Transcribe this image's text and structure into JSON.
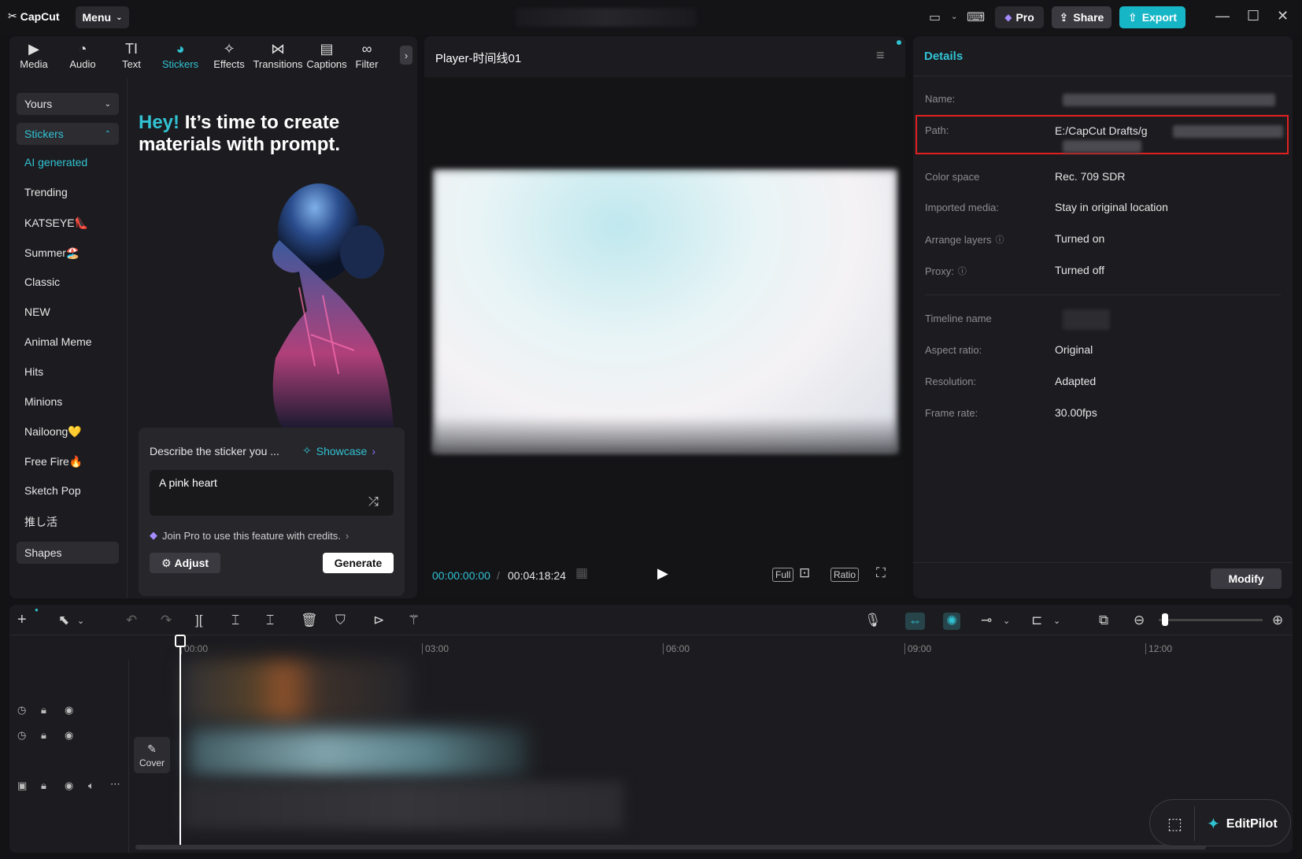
{
  "app": {
    "logo_text": "CapCut",
    "menu_label": "Menu"
  },
  "header": {
    "pro_label": "Pro",
    "share_label": "Share",
    "export_label": "Export"
  },
  "toolbar": {
    "tools": [
      {
        "label": "Media",
        "icon": "media-icon"
      },
      {
        "label": "Audio",
        "icon": "audio-icon"
      },
      {
        "label": "Text",
        "icon": "text-icon"
      },
      {
        "label": "Stickers",
        "icon": "stickers-icon"
      },
      {
        "label": "Effects",
        "icon": "effects-icon"
      },
      {
        "label": "Transitions",
        "icon": "transitions-icon"
      },
      {
        "label": "Captions",
        "icon": "captions-icon"
      },
      {
        "label": "Filter",
        "icon": "filter-icon"
      }
    ]
  },
  "sidebar": {
    "yours_label": "Yours",
    "stickers_label": "Stickers",
    "shapes_label": "Shapes",
    "items": [
      "AI generated",
      "Trending",
      "KATSEYE👠",
      "Summer🏖️",
      "Classic",
      "NEW",
      "Animal Meme",
      "Hits",
      "Minions",
      "Nailoong💛",
      "Free Fire🔥",
      "Sketch Pop",
      "推し活"
    ]
  },
  "ai_panel": {
    "hey": "Hey!",
    "title_rest": " It’s time to create materials with prompt.",
    "prompt_label": "Describe the sticker you ...",
    "showcase_label": "Showcase",
    "prompt_value": "A pink heart",
    "join_pro": "Join Pro to use this feature with credits.",
    "adjust_label": "Adjust",
    "generate_label": "Generate"
  },
  "player": {
    "title": "Player-时间线01",
    "current_time": "00:00:00:00",
    "total_time": "00:04:18:24",
    "full_label": "Full",
    "ratio_label": "Ratio"
  },
  "details": {
    "title": "Details",
    "name_label": "Name:",
    "path_label": "Path:",
    "path_value": "E:/CapCut Drafts/g",
    "color_space_label": "Color space",
    "color_space_value": "Rec. 709 SDR",
    "imported_media_label": "Imported media:",
    "imported_media_value": "Stay in original location",
    "arrange_layers_label": "Arrange layers",
    "arrange_layers_value": "Turned on",
    "proxy_label": "Proxy:",
    "proxy_value": "Turned off",
    "timeline_name_label": "Timeline name",
    "aspect_ratio_label": "Aspect ratio:",
    "aspect_ratio_value": "Original",
    "resolution_label": "Resolution:",
    "resolution_value": "Adapted",
    "frame_rate_label": "Frame rate:",
    "frame_rate_value": "30.00fps",
    "modify_label": "Modify"
  },
  "timeline": {
    "ticks": [
      "00:00",
      "03:00",
      "06:00",
      "09:00",
      "12:00"
    ],
    "cover_label": "Cover"
  },
  "editpilot": {
    "label": "EditPilot"
  },
  "colors": {
    "accent": "#31c2d2",
    "highlight_border": "#e02020"
  }
}
